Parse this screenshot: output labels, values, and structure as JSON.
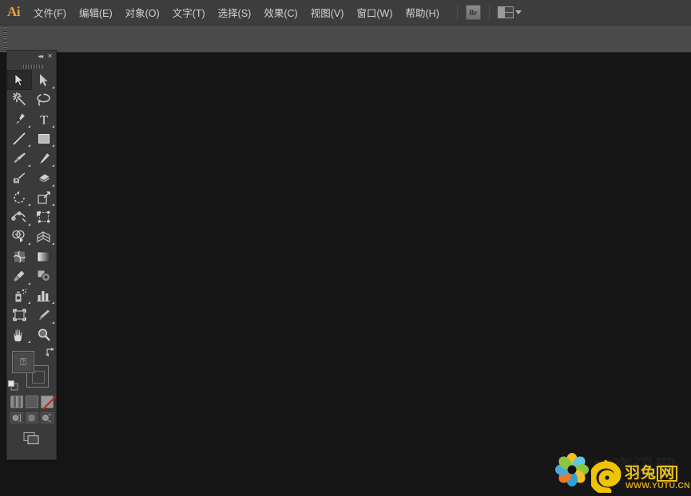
{
  "app": {
    "logo_text": "Ai",
    "accent_color": "#e6a340",
    "canvas_color": "#161616",
    "panel_color": "#3a3a3a",
    "menubar_color": "#3d3d3d",
    "controlbar_color": "#4b4b4b"
  },
  "menubar": {
    "items": [
      {
        "label": "文件(F)",
        "name": "menu-file"
      },
      {
        "label": "编辑(E)",
        "name": "menu-edit"
      },
      {
        "label": "对象(O)",
        "name": "menu-object"
      },
      {
        "label": "文字(T)",
        "name": "menu-type"
      },
      {
        "label": "选择(S)",
        "name": "menu-select"
      },
      {
        "label": "效果(C)",
        "name": "menu-effect"
      },
      {
        "label": "视图(V)",
        "name": "menu-view"
      },
      {
        "label": "窗口(W)",
        "name": "menu-window"
      },
      {
        "label": "帮助(H)",
        "name": "menu-help"
      }
    ],
    "bridge_label": "Br",
    "bridge_icon": "bridge-icon",
    "arrange_icon": "arrange-documents-icon",
    "arrange_caret": "chevron-down-icon"
  },
  "controlbar": {
    "grabber": "panel-grabber",
    "content": ""
  },
  "toolpanel": {
    "collapse_glyph": "◂◂",
    "close_glyph": "✕",
    "tools": [
      {
        "name": "selection-tool",
        "icon": "arrow-solid-icon",
        "active": true,
        "more": false
      },
      {
        "name": "direct-selection-tool",
        "icon": "arrow-outline-icon",
        "active": false,
        "more": true
      },
      {
        "name": "magic-wand-tool",
        "icon": "magic-wand-icon",
        "active": false,
        "more": false
      },
      {
        "name": "lasso-tool",
        "icon": "lasso-icon",
        "active": false,
        "more": false
      },
      {
        "name": "pen-tool",
        "icon": "pen-nib-icon",
        "active": false,
        "more": true
      },
      {
        "name": "type-tool",
        "icon": "type-t-icon",
        "active": false,
        "more": true
      },
      {
        "name": "line-segment-tool",
        "icon": "line-segment-icon",
        "active": false,
        "more": true
      },
      {
        "name": "rectangle-tool",
        "icon": "rectangle-icon",
        "active": false,
        "more": true
      },
      {
        "name": "paintbrush-tool",
        "icon": "paintbrush-icon",
        "active": false,
        "more": true
      },
      {
        "name": "pencil-tool",
        "icon": "pencil-icon",
        "active": false,
        "more": true
      },
      {
        "name": "blob-brush-tool",
        "icon": "blob-brush-icon",
        "active": false,
        "more": false
      },
      {
        "name": "eraser-tool",
        "icon": "eraser-icon",
        "active": false,
        "more": true
      },
      {
        "name": "rotate-tool",
        "icon": "rotate-icon",
        "active": false,
        "more": true
      },
      {
        "name": "scale-tool",
        "icon": "scale-icon",
        "active": false,
        "more": true
      },
      {
        "name": "width-tool",
        "icon": "width-warp-icon",
        "active": false,
        "more": true
      },
      {
        "name": "free-transform-tool",
        "icon": "free-transform-icon",
        "active": false,
        "more": false
      },
      {
        "name": "shape-builder-tool",
        "icon": "shape-builder-icon",
        "active": false,
        "more": true
      },
      {
        "name": "perspective-grid-tool",
        "icon": "perspective-grid-icon",
        "active": false,
        "more": true
      },
      {
        "name": "mesh-tool",
        "icon": "mesh-icon",
        "active": false,
        "more": false
      },
      {
        "name": "gradient-tool",
        "icon": "gradient-icon",
        "active": false,
        "more": false
      },
      {
        "name": "eyedropper-tool",
        "icon": "eyedropper-icon",
        "active": false,
        "more": true
      },
      {
        "name": "blend-tool",
        "icon": "blend-icon",
        "active": false,
        "more": false
      },
      {
        "name": "symbol-sprayer-tool",
        "icon": "symbol-sprayer-icon",
        "active": false,
        "more": true
      },
      {
        "name": "column-graph-tool",
        "icon": "column-graph-icon",
        "active": false,
        "more": true
      },
      {
        "name": "artboard-tool",
        "icon": "artboard-icon",
        "active": false,
        "more": false
      },
      {
        "name": "slice-tool",
        "icon": "slice-icon",
        "active": false,
        "more": true
      },
      {
        "name": "hand-tool",
        "icon": "hand-icon",
        "active": false,
        "more": true
      },
      {
        "name": "zoom-tool",
        "icon": "magnifier-icon",
        "active": false,
        "more": false
      }
    ],
    "fill_stroke": {
      "fill_label": "⍰",
      "fill_name": "fill-swatch",
      "stroke_name": "stroke-swatch",
      "swap_name": "swap-fill-stroke-icon",
      "default_name": "default-fill-stroke-icon"
    },
    "swatch_modes": [
      {
        "name": "color-swatch-button",
        "icon": "color-icon"
      },
      {
        "name": "gradient-swatch-button",
        "icon": "gradient-icon"
      },
      {
        "name": "none-swatch-button",
        "icon": "none-slash-icon"
      }
    ],
    "draw_modes": [
      {
        "name": "draw-normal-button",
        "icon": "draw-normal-icon"
      },
      {
        "name": "draw-behind-button",
        "icon": "draw-behind-icon"
      },
      {
        "name": "draw-inside-button",
        "icon": "draw-inside-icon"
      }
    ],
    "screen_mode": {
      "name": "change-screen-mode-button",
      "icon": "screen-mode-icon"
    }
  },
  "watermark": {
    "site_text_back": "AI资讯网",
    "brand_chars": [
      "羽",
      "兔",
      "网"
    ],
    "url": "WWW.YUTU.CN",
    "flower_icon": "flower-logo-icon",
    "rabbit_icon": "rabbit-logo-icon",
    "brand_color": "#e8c21a",
    "url_color": "#d99e14"
  }
}
